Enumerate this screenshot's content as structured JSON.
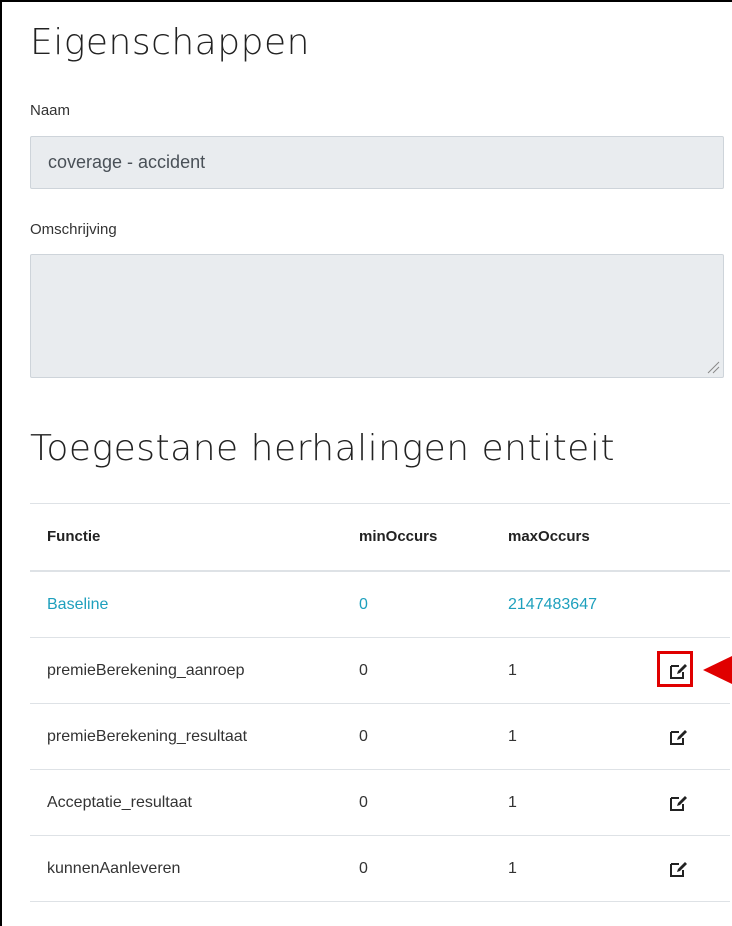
{
  "properties": {
    "title": "Eigenschappen",
    "name_label": "Naam",
    "name_value": "coverage - accident",
    "description_label": "Omschrijving",
    "description_value": ""
  },
  "repetitions": {
    "title": "Toegestane herhalingen entiteit",
    "columns": [
      "Functie",
      "minOccurs",
      "maxOccurs",
      ""
    ],
    "rows": [
      {
        "functie": "Baseline",
        "min": "0",
        "max": "2147483647",
        "editable": false,
        "link": true
      },
      {
        "functie": "premieBerekening_aanroep",
        "min": "0",
        "max": "1",
        "editable": true,
        "icon": "edit-icon"
      },
      {
        "functie": "premieBerekening_resultaat",
        "min": "0",
        "max": "1",
        "editable": true,
        "icon": "edit-icon"
      },
      {
        "functie": "Acceptatie_resultaat",
        "min": "0",
        "max": "1",
        "editable": true,
        "icon": "edit-icon"
      },
      {
        "functie": "kunnenAanleveren",
        "min": "0",
        "max": "1",
        "editable": true,
        "icon": "edit-icon"
      }
    ]
  },
  "colors": {
    "link": "#1ea0bd",
    "highlight": "#e00000",
    "input_bg": "#e9ecef"
  }
}
